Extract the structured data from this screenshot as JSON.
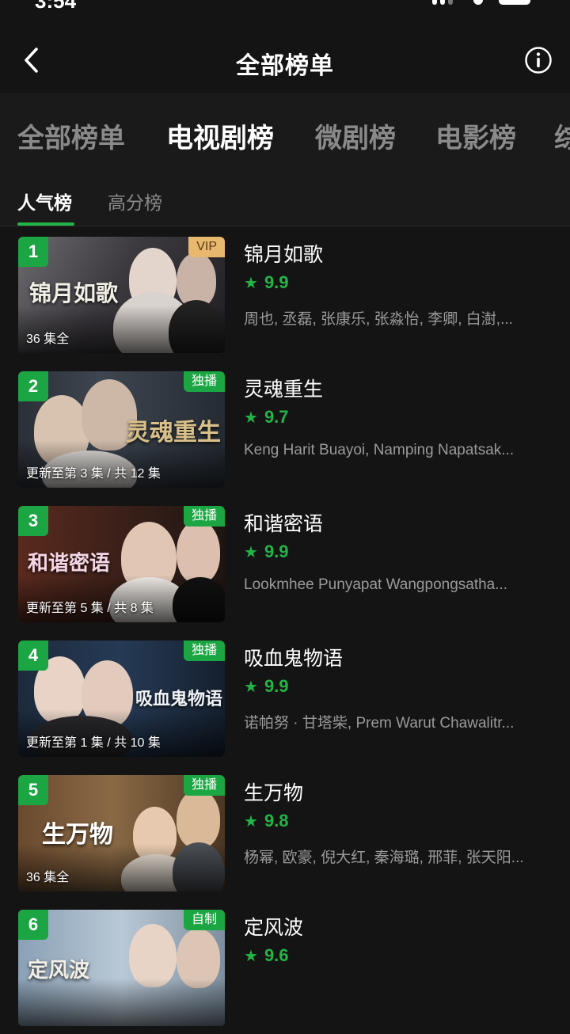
{
  "status": {
    "time": "3:54"
  },
  "header": {
    "title": "全部榜单"
  },
  "category_tabs": [
    "全部榜单",
    "电视剧榜",
    "微剧榜",
    "电影榜",
    "综"
  ],
  "sub_tabs": [
    "人气榜",
    "高分榜"
  ],
  "colors": {
    "accent": "#22b447",
    "rank_bg": "#1ca643",
    "vip_badge": "#e9b86f",
    "background": "#141414"
  },
  "icons": {
    "back": "chevron-left-icon",
    "info": "info-icon",
    "star": "star-icon"
  },
  "items": [
    {
      "rank": "1",
      "badge": "VIP",
      "episodes": "36 集全",
      "title": "锦月如歌",
      "score": "9.9",
      "cast": "周也, 丞磊, 张康乐, 张淼怡, 李卿, 白澍,...",
      "poster_logo": "锦月如歌"
    },
    {
      "rank": "2",
      "badge": "独播",
      "episodes": "更新至第 3 集 / 共 12 集",
      "title": "灵魂重生",
      "score": "9.7",
      "cast": "Keng Harit Buayoi, Namping Napatsak...",
      "poster_logo": "灵魂重生"
    },
    {
      "rank": "3",
      "badge": "独播",
      "episodes": "更新至第 5 集 / 共 8 集",
      "title": "和谐密语",
      "score": "9.9",
      "cast": "Lookmhee Punyapat Wangpongsatha...",
      "poster_logo": "和谐密语"
    },
    {
      "rank": "4",
      "badge": "独播",
      "episodes": "更新至第 1 集 / 共 10 集",
      "title": "吸血鬼物语",
      "score": "9.9",
      "cast": "诺帕努 · 甘塔柴, Prem Warut Chawalitr...",
      "poster_logo": "吸血鬼物语"
    },
    {
      "rank": "5",
      "badge": "独播",
      "episodes": "36 集全",
      "title": "生万物",
      "score": "9.8",
      "cast": "杨幂, 欧豪, 倪大红, 秦海璐, 邢菲, 张天阳...",
      "poster_logo": "生万物"
    },
    {
      "rank": "6",
      "badge": "自制",
      "episodes": "",
      "title": "定风波",
      "score": "9.6",
      "cast": "",
      "poster_logo": "定风波"
    }
  ]
}
